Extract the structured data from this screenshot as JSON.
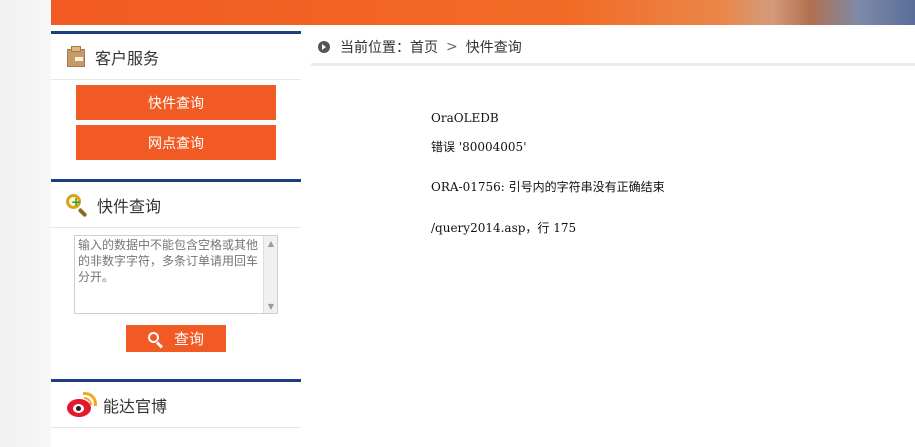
{
  "sidebar": {
    "service": {
      "title": "客户服务",
      "buttons": [
        "快件查询",
        "网点查询"
      ]
    },
    "query": {
      "title": "快件查询",
      "placeholder": "输入的数据中不能包含空格或其他的非数字字符，多条订单请用回车分开。",
      "button": "查询"
    },
    "weibo": {
      "title": "能达官博"
    }
  },
  "breadcrumb": {
    "label": "当前位置：",
    "home": "首页",
    "separator": ">",
    "current": "快件查询"
  },
  "error": {
    "source": "OraOLEDB",
    "code_line": "错误 '80004005'",
    "message": "ORA-01756: 引号内的字符串没有正确结束",
    "location": "/query2014.asp，行 175"
  },
  "colors": {
    "accent": "#f15a22",
    "border_blue": "#1c3d7e"
  }
}
